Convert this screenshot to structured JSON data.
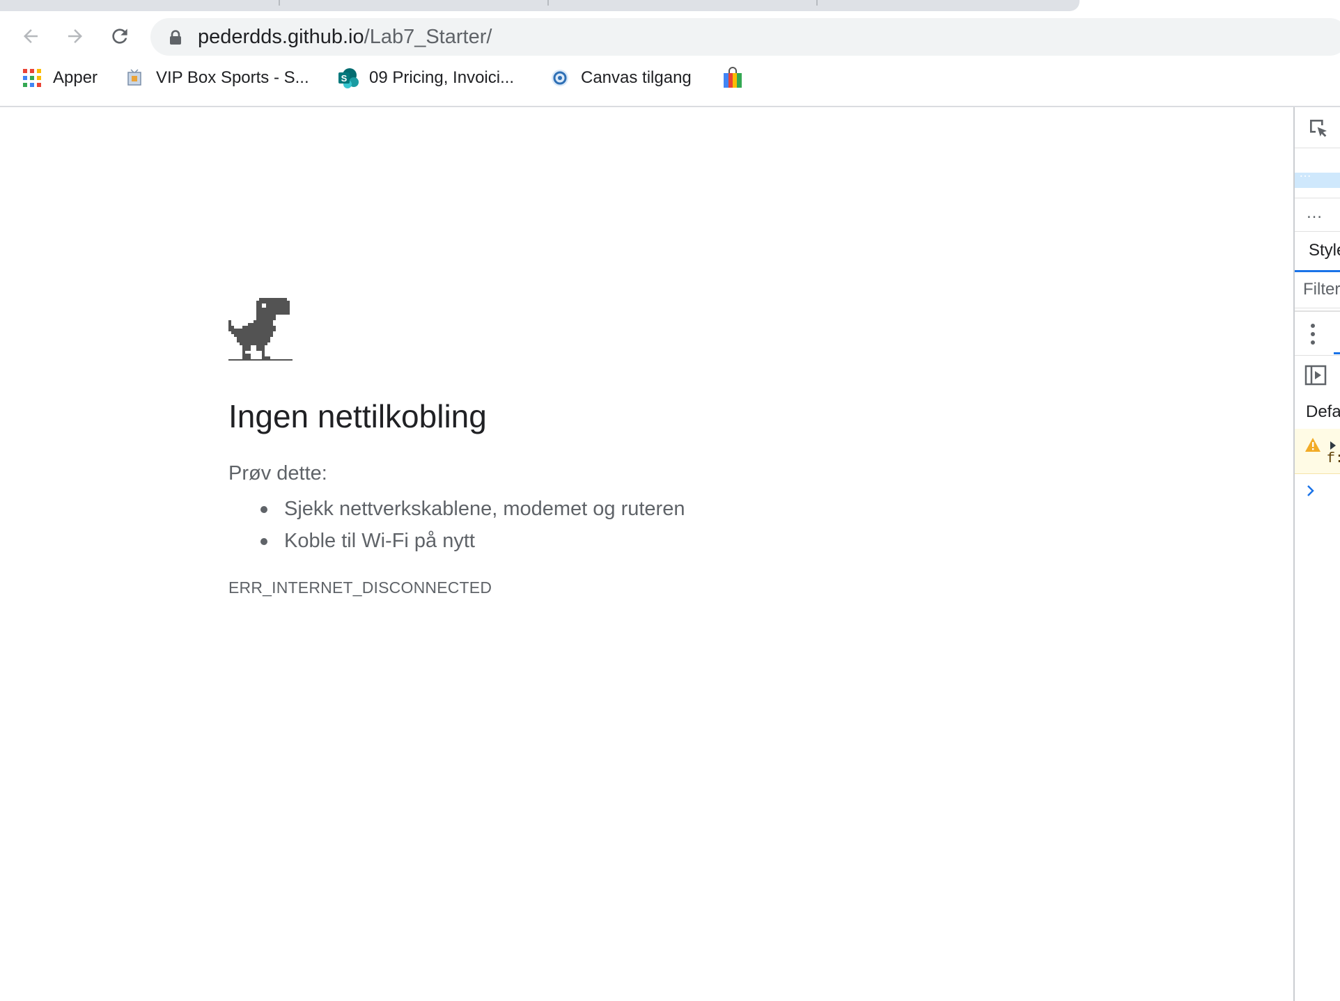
{
  "browser": {
    "url_host": "pederdds.github.io",
    "url_path": "/Lab7_Starter/",
    "icons": {
      "back": "arrow-left-icon",
      "forward": "arrow-right-icon",
      "reload": "reload-icon",
      "lock": "lock-icon"
    }
  },
  "bookmarks": [
    {
      "label": "Apper",
      "icon": "apps-grid-icon"
    },
    {
      "label": "VIP Box Sports - S...",
      "icon": "tv-icon"
    },
    {
      "label": "09 Pricing, Invoici...",
      "icon": "sharepoint-icon"
    },
    {
      "label": "Canvas tilgang",
      "icon": "canvas-icon"
    },
    {
      "label": "",
      "icon": "shopping-bag-icon"
    }
  ],
  "error_page": {
    "title": "Ingen nettilkobling",
    "suggestions_heading": "Prøv dette:",
    "suggestions": [
      "Sjekk nettverkskablene, modemet og ruteren",
      "Koble til Wi-Fi på nytt"
    ],
    "error_code": "ERR_INTERNET_DISCONNECTED",
    "icon": "dino-icon"
  },
  "devtools": {
    "styles_tab": "Style",
    "filter_placeholder": "Filter",
    "default_label": "Defa",
    "console_warning_text": "f:",
    "colors": {
      "accent": "#1a73e8",
      "warning_bg": "#fffbe5",
      "warning_icon": "#f2ab26"
    }
  }
}
